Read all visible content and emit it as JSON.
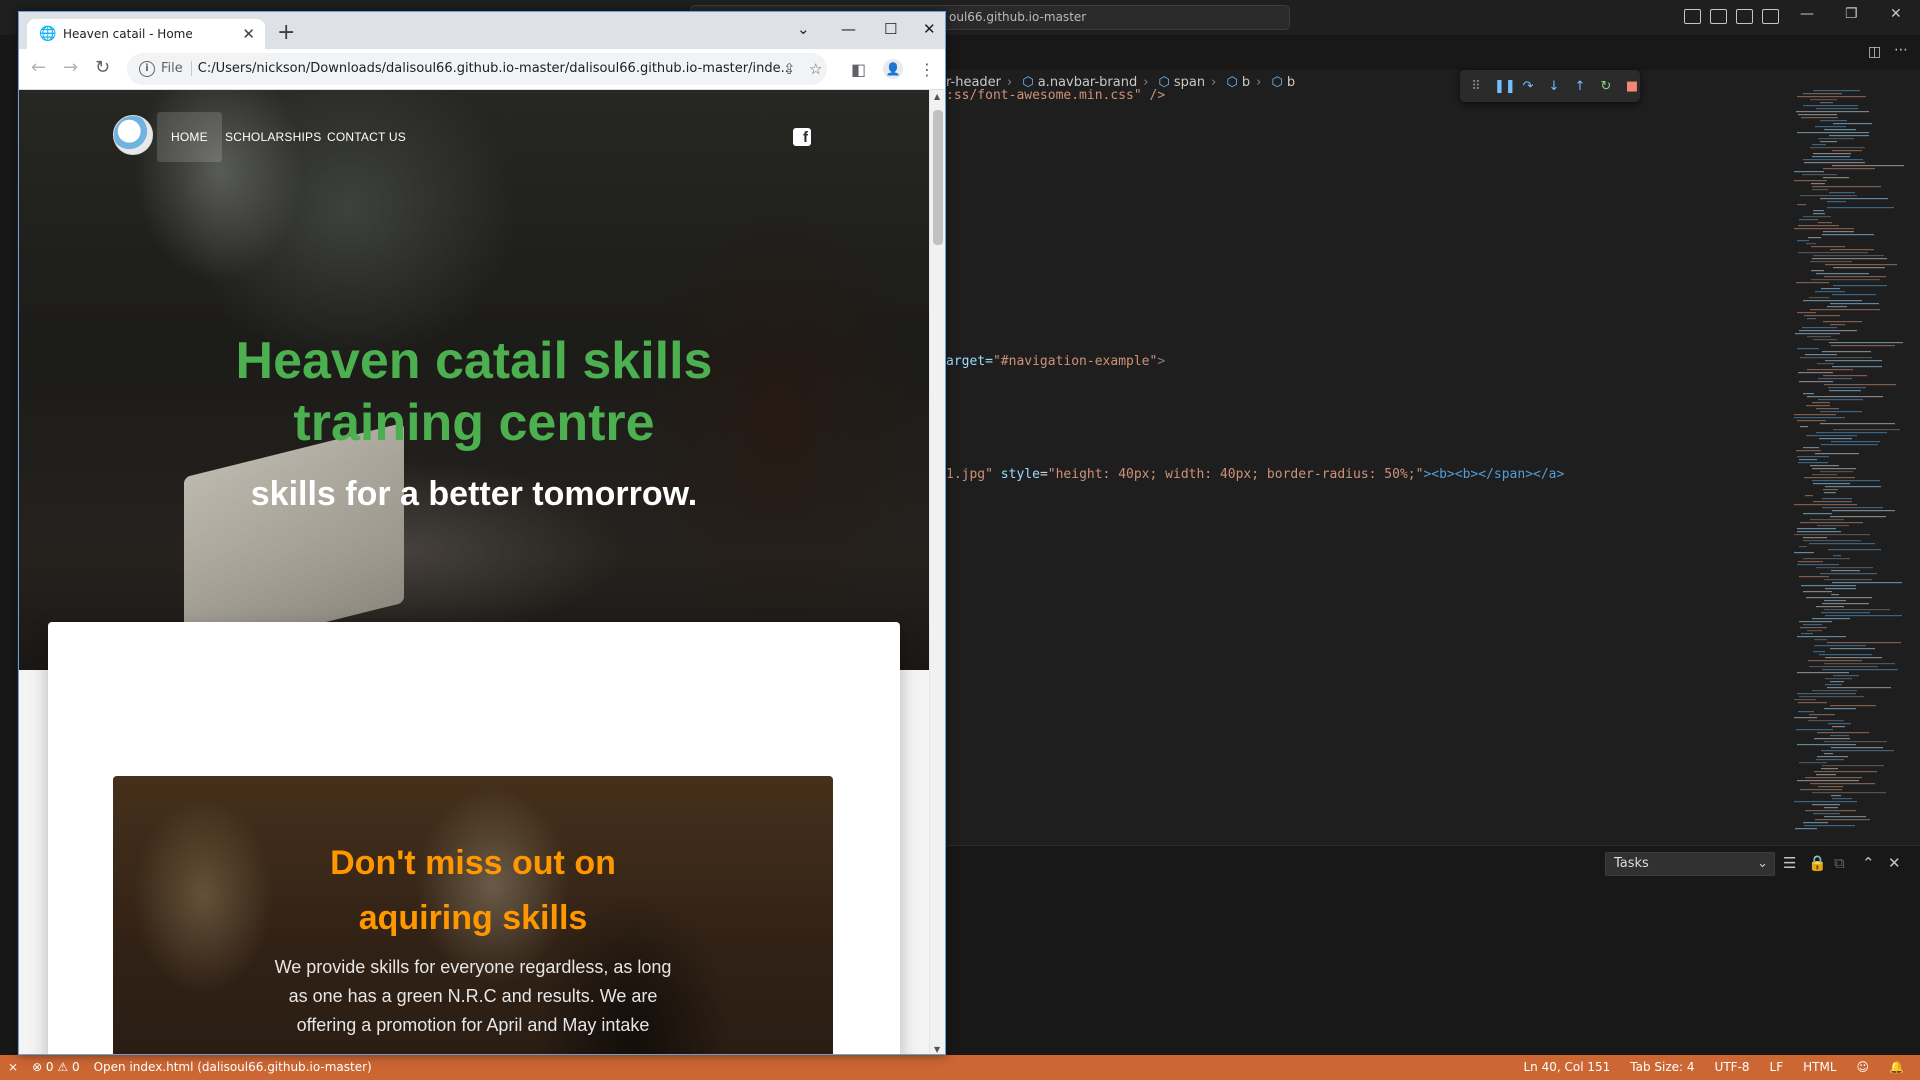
{
  "vscode": {
    "search_text": "oul66.github.io-master",
    "breadcrumb": [
      "r-header",
      "a.navbar-brand",
      "span",
      "b",
      "b"
    ],
    "code": {
      "line1": ":ss/font-awesome.min.css\" />",
      "line2_pre": "arget=",
      "line2_str": "\"#navigation-example\"",
      "line2_end": ">",
      "line3_str": "1.jpg\"",
      "line3_attr": "style",
      "line3_eq": "=",
      "line3_val": "\"height: 40px; width: 40px; border-radius: 50%;\"",
      "line3_tail": "><b><b></span></a>"
    },
    "panel": {
      "tasks_label": "Tasks"
    },
    "status": {
      "errors": "⊗ 0 ⚠ 0",
      "open_file": "Open index.html (dalisoul66.github.io-master)",
      "position": "Ln 40, Col 151",
      "tab_size": "Tab Size: 4",
      "encoding": "UTF-8",
      "eol": "LF",
      "language": "HTML"
    }
  },
  "chrome": {
    "tab_title": "Heaven catail - Home",
    "url_scheme": "File",
    "url": "C:/Users/nickson/Downloads/dalisoul66.github.io-master/dalisoul66.github.io-master/inde..."
  },
  "site": {
    "nav": {
      "home": "HOME",
      "scholarships": "SCHOLARSHIPS",
      "contact": "CONTACT US"
    },
    "hero_title": "Heaven catail skills training centre",
    "hero_subtitle": "skills for a better tomorrow.",
    "promo_title": "Don't miss out on aquiring skills",
    "promo_text": "We provide skills for everyone regardless, as long as one has a green N.R.C and results. We are offering a promotion for April and May intake"
  },
  "colors": {
    "hero_title": "#4caf50",
    "promo_title": "#ff9800",
    "status_bar": "#cc6633"
  }
}
